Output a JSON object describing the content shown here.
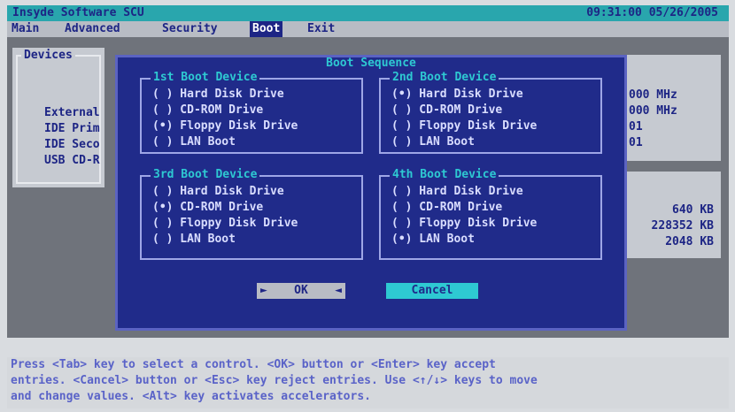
{
  "titlebar": {
    "vendor": "Insyde Software SCU",
    "time": "09:31:00",
    "date": "05/26/2005"
  },
  "menu": [
    "Main",
    "Advanced",
    "Security",
    "Boot",
    "Exit"
  ],
  "background": {
    "devices_label": "Devices",
    "left_rows": [
      "External",
      "IDE Prim",
      "IDE Seco",
      "USB CD-R"
    ],
    "right_top": [
      "000 MHz",
      "000 MHz",
      "01",
      "01"
    ],
    "right_bottom": [
      "640 KB",
      "228352 KB",
      "2048 KB"
    ]
  },
  "dialog": {
    "title": "Boot Sequence",
    "groups": [
      {
        "label": "1st Boot Device",
        "options": [
          "( ) Hard Disk Drive",
          "( ) CD-ROM Drive",
          "(•) Floppy Disk Drive",
          "( ) LAN Boot"
        ]
      },
      {
        "label": "2nd Boot Device",
        "options": [
          "(•) Hard Disk Drive",
          "( ) CD-ROM Drive",
          "( ) Floppy Disk Drive",
          "( ) LAN Boot"
        ]
      },
      {
        "label": "3rd Boot Device",
        "options": [
          "( ) Hard Disk Drive",
          "(•) CD-ROM Drive",
          "( ) Floppy Disk Drive",
          "( ) LAN Boot"
        ]
      },
      {
        "label": "4th Boot Device",
        "options": [
          "( ) Hard Disk Drive",
          "( ) CD-ROM Drive",
          "( ) Floppy Disk Drive",
          "(•) LAN Boot"
        ]
      }
    ],
    "ok_label": "OK",
    "cancel_label": "Cancel"
  },
  "help": [
    "Press <Tab> key to select a control. <OK> button or <Enter> key accept",
    "entries. <Cancel> button or <Esc> key reject entries. Use <↑/↓> keys to move",
    "and change values. <Alt> key activates accelerators."
  ]
}
